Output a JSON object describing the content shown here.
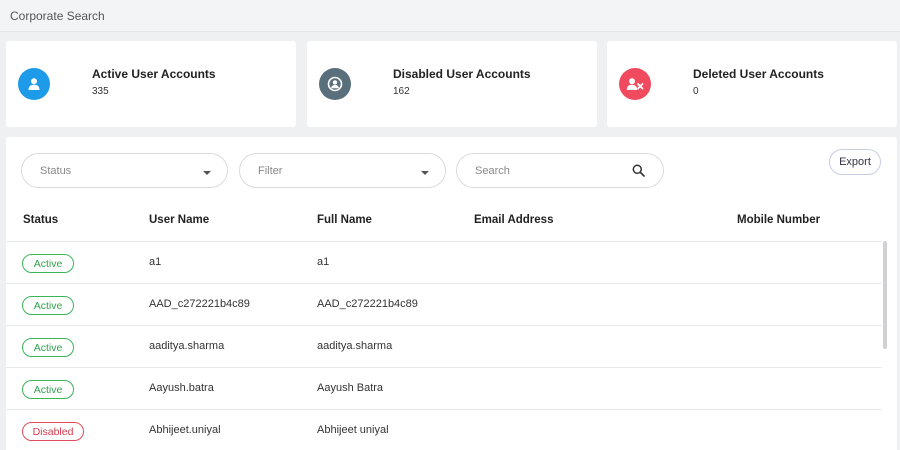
{
  "header": {
    "title": "Corporate Search"
  },
  "cards": [
    {
      "label": "Active User Accounts",
      "count": "335",
      "color": "#1e9be8",
      "icon": "user-icon"
    },
    {
      "label": "Disabled User Accounts",
      "count": "162",
      "color": "#5a6f7c",
      "icon": "user-circle-icon"
    },
    {
      "label": "Deleted User Accounts",
      "count": "0",
      "color": "#f04a5e",
      "icon": "user-x-icon"
    }
  ],
  "filters": {
    "status_placeholder": "Status",
    "filter_placeholder": "Filter",
    "search_placeholder": "Search",
    "export_label": "Export"
  },
  "table": {
    "columns": [
      "Status",
      "User Name",
      "Full Name",
      "Email Address",
      "Mobile Number"
    ],
    "rows": [
      {
        "status": "Active",
        "user_name": "a1",
        "full_name": "a1",
        "email": "",
        "mobile": ""
      },
      {
        "status": "Active",
        "user_name": "AAD_c272221b4c89",
        "full_name": "AAD_c272221b4c89",
        "email": "",
        "mobile": ""
      },
      {
        "status": "Active",
        "user_name": "aaditya.sharma",
        "full_name": "aaditya.sharma",
        "email": "",
        "mobile": ""
      },
      {
        "status": "Active",
        "user_name": "Aayush.batra",
        "full_name": "Aayush Batra",
        "email": "",
        "mobile": ""
      },
      {
        "status": "Disabled",
        "user_name": "Abhijeet.uniyal",
        "full_name": "Abhijeet uniyal",
        "email": "",
        "mobile": ""
      }
    ]
  },
  "colors": {
    "active": "#2fa34e",
    "disabled": "#d73a4d"
  }
}
